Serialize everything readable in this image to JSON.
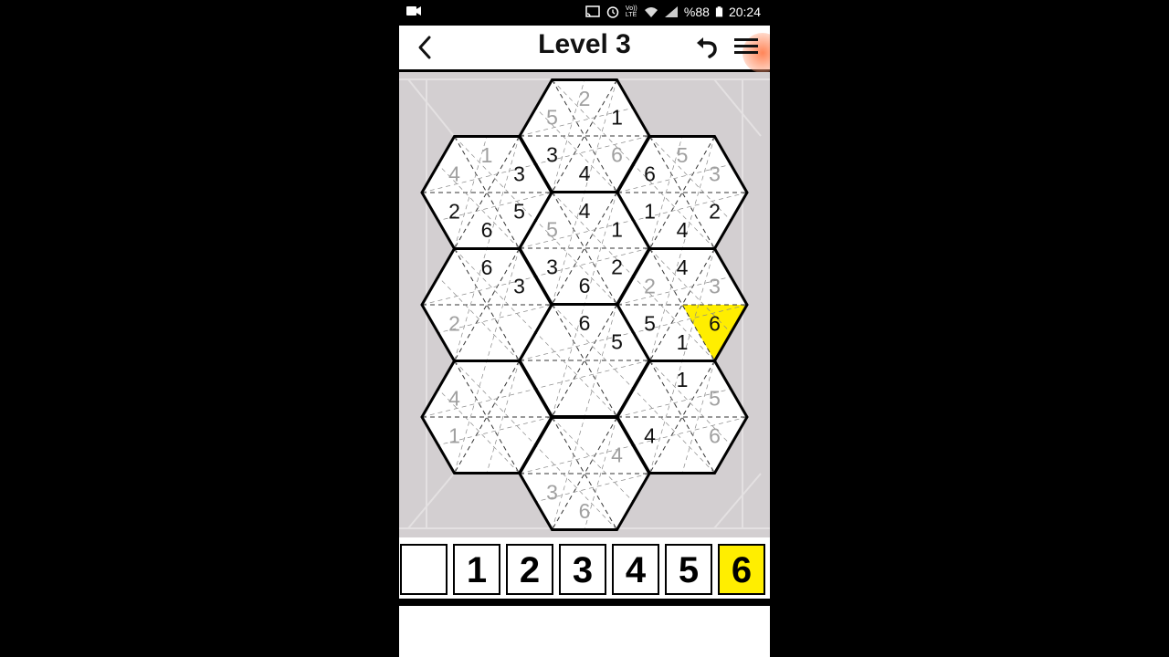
{
  "status_bar": {
    "battery": "%88",
    "time": "20:24",
    "network": "Vo)) LTE"
  },
  "header": {
    "title": "Level 3"
  },
  "colors": {
    "highlight": "#ffee00",
    "given": "#111111",
    "hint": "#a0a0a0",
    "board_background": "#d3cfd1"
  },
  "board": {
    "hexes": [
      {
        "id": "top",
        "digits": {
          "top": "2",
          "upper_right": "1",
          "lower_right": "6",
          "bottom": "4",
          "lower_left": "3",
          "upper_left": "5"
        },
        "given": {
          "top": false,
          "upper_right": true,
          "lower_right": false,
          "bottom": true,
          "lower_left": true,
          "upper_left": false
        }
      },
      {
        "id": "upper-left",
        "digits": {
          "top": "1",
          "upper_right": "3",
          "lower_right": "5",
          "bottom": "6",
          "lower_left": "2",
          "upper_left": "4"
        },
        "given": {
          "top": false,
          "upper_right": true,
          "lower_right": true,
          "bottom": true,
          "lower_left": true,
          "upper_left": false
        }
      },
      {
        "id": "upper-right",
        "digits": {
          "top": "5",
          "upper_right": "3",
          "lower_right": "2",
          "bottom": "4",
          "lower_left": "1",
          "upper_left": "6"
        },
        "given": {
          "top": false,
          "upper_right": false,
          "lower_right": true,
          "bottom": true,
          "lower_left": true,
          "upper_left": true
        }
      },
      {
        "id": "center-upper",
        "digits": {
          "top": "4",
          "upper_right": "1",
          "lower_right": "2",
          "bottom": "6",
          "lower_left": "3",
          "upper_left": "5"
        },
        "given": {
          "top": true,
          "upper_right": true,
          "lower_right": true,
          "bottom": true,
          "lower_left": true,
          "upper_left": false
        }
      },
      {
        "id": "middle-left",
        "digits": {
          "top": "6",
          "upper_right": "3",
          "lower_right": "",
          "bottom": "",
          "lower_left": "2",
          "upper_left": ""
        },
        "given": {
          "top": true,
          "upper_right": true,
          "lower_right": false,
          "bottom": false,
          "lower_left": false,
          "upper_left": false
        }
      },
      {
        "id": "middle-right",
        "digits": {
          "top": "4",
          "upper_right": "3",
          "lower_right": "6",
          "bottom": "1",
          "lower_left": "5",
          "upper_left": "2"
        },
        "given": {
          "top": true,
          "upper_right": false,
          "lower_right": true,
          "bottom": true,
          "lower_left": true,
          "upper_left": false
        },
        "selected": "lower_right"
      },
      {
        "id": "center-lower",
        "digits": {
          "top": "6",
          "upper_right": "5",
          "lower_right": "",
          "bottom": "",
          "lower_left": "",
          "upper_left": ""
        },
        "given": {
          "top": true,
          "upper_right": true,
          "lower_right": false,
          "bottom": false,
          "lower_left": false,
          "upper_left": false
        }
      },
      {
        "id": "lower-left",
        "digits": {
          "top": "",
          "upper_right": "",
          "lower_right": "",
          "bottom": "",
          "lower_left": "1",
          "upper_left": "4"
        },
        "given": {
          "top": false,
          "upper_right": false,
          "lower_right": false,
          "bottom": false,
          "lower_left": false,
          "upper_left": false
        }
      },
      {
        "id": "lower-right",
        "digits": {
          "top": "1",
          "upper_right": "5",
          "lower_right": "6",
          "bottom": "",
          "lower_left": "4",
          "upper_left": ""
        },
        "given": {
          "top": true,
          "upper_right": false,
          "lower_right": false,
          "bottom": false,
          "lower_left": true,
          "upper_left": false
        }
      },
      {
        "id": "bottom",
        "digits": {
          "top": "",
          "upper_right": "4",
          "lower_right": "",
          "bottom": "6",
          "lower_left": "3",
          "upper_left": ""
        },
        "given": {
          "top": false,
          "upper_right": false,
          "lower_right": false,
          "bottom": false,
          "lower_left": false,
          "upper_left": false
        }
      }
    ]
  },
  "palette": {
    "options": [
      "",
      "1",
      "2",
      "3",
      "4",
      "5",
      "6"
    ],
    "selected": "6"
  }
}
